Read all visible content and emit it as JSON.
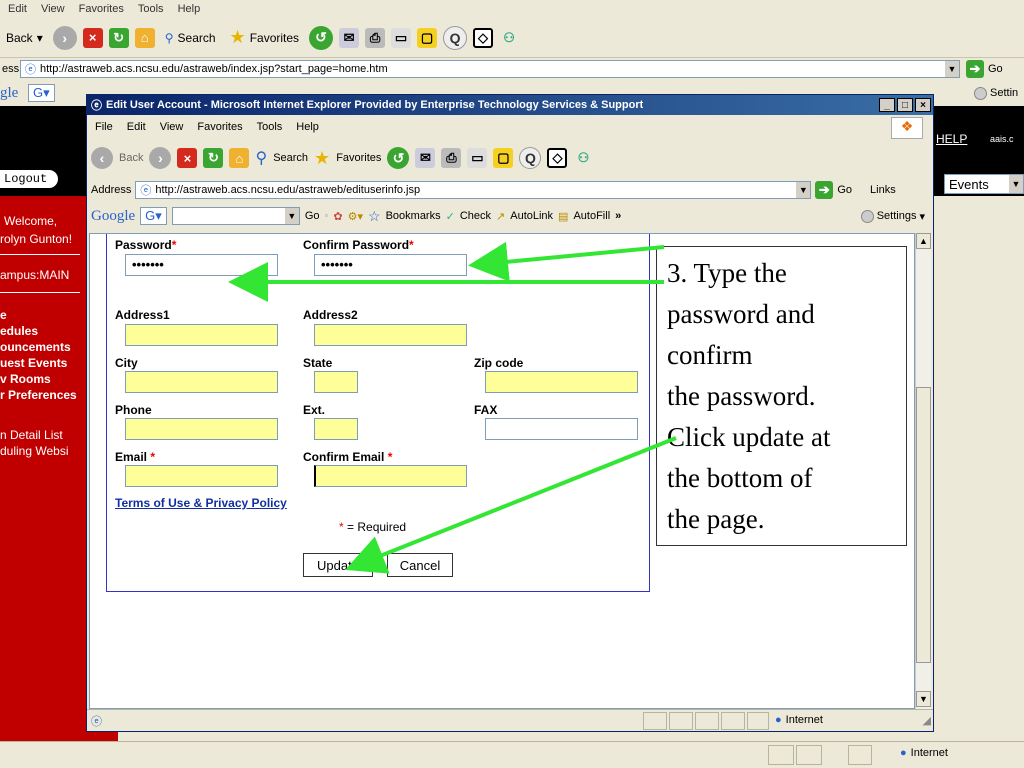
{
  "outer": {
    "menu": [
      "Edit",
      "View",
      "Favorites",
      "Tools",
      "Help"
    ],
    "back_label": "Back",
    "search_label": "Search",
    "favorites_label": "Favorites",
    "address_prefix": "ess",
    "address_url": "http://astraweb.acs.ncsu.edu/astraweb/index.jsp?start_page=home.htm",
    "go_label": "Go",
    "google_label": "gle",
    "settings_label": "Settin",
    "help_link": "HELP",
    "user_short": "aais.c",
    "events_select": "Events",
    "status_internet": "Internet"
  },
  "sidebar": {
    "logout": "Logout",
    "welcome": "Welcome,",
    "user": "rolyn Gunton!",
    "campus": "ampus:MAIN",
    "items": [
      "e",
      "edules",
      "ouncements",
      "uest Events",
      "v Rooms",
      "r Preferences",
      "n Detail List",
      "duling Websi"
    ]
  },
  "popup": {
    "title": "Edit User Account - Microsoft Internet Explorer Provided by Enterprise Technology Services & Support",
    "menu": [
      "File",
      "Edit",
      "View",
      "Favorites",
      "Tools",
      "Help"
    ],
    "back_label": "Back",
    "search_label": "Search",
    "favorites_label": "Favorites",
    "address_label": "Address",
    "address_url": "http://astraweb.acs.ncsu.edu/astraweb/edituserinfo.jsp",
    "go_label": "Go",
    "links_label": "Links",
    "google_bar": {
      "go": "Go",
      "bookmarks": "Bookmarks",
      "check": "Check",
      "autolink": "AutoLink",
      "autofill": "AutoFill",
      "settings": "Settings"
    },
    "status_internet": "Internet"
  },
  "form": {
    "password_label": "Password",
    "confirm_password_label": "Confirm Password",
    "password_value": "•••••••",
    "confirm_password_value": "•••••••",
    "address1_label": "Address1",
    "address2_label": "Address2",
    "city_label": "City",
    "state_label": "State",
    "zip_label": "Zip code",
    "phone_label": "Phone",
    "ext_label": "Ext.",
    "fax_label": "FAX",
    "email_label": "Email",
    "confirm_email_label": "Confirm Email",
    "terms_link": "Terms of Use & Privacy Policy",
    "required_note": "= Required",
    "required_star": "*",
    "update_button": "Update",
    "cancel_button": "Cancel"
  },
  "callout": {
    "lines": [
      "3. Type the",
      "password and",
      "confirm",
      "the password.",
      "Click update at",
      "the bottom of",
      "the page."
    ]
  },
  "colors": {
    "arrow": "#33e633",
    "sidebar": "#c00000",
    "field": "#ffff99",
    "titlebar": "#0a246a"
  }
}
